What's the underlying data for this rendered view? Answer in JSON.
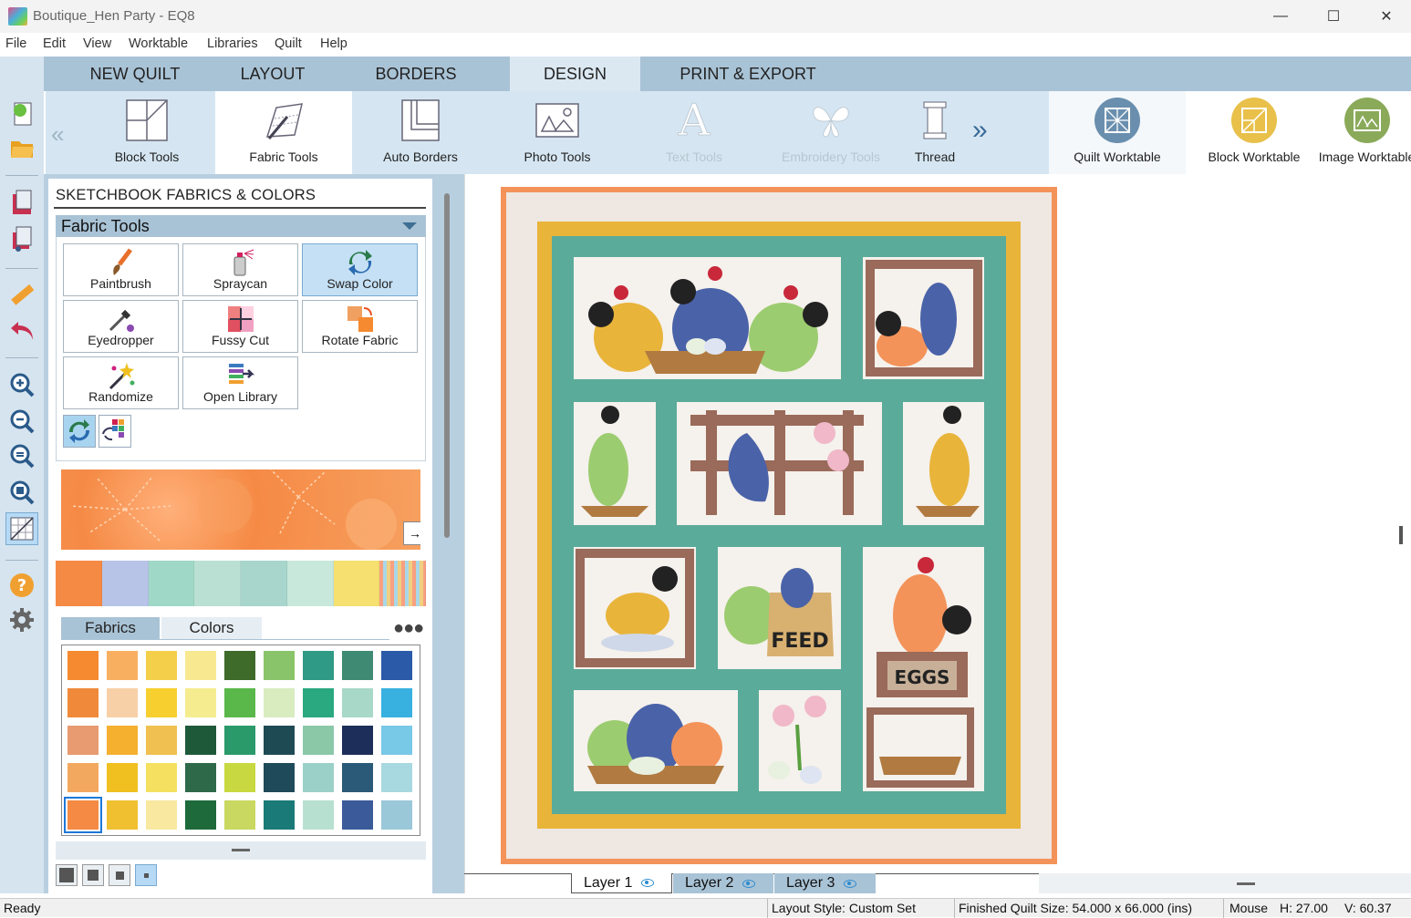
{
  "window": {
    "title": "Boutique_Hen Party - EQ8",
    "minimize": "—",
    "maximize": "☐",
    "close": "✕"
  },
  "menu": [
    "File",
    "Edit",
    "View",
    "Worktable",
    "Libraries",
    "Quilt",
    "Help"
  ],
  "tabs": [
    "NEW QUILT",
    "LAYOUT",
    "BORDERS",
    "DESIGN",
    "PRINT & EXPORT"
  ],
  "active_tab": "DESIGN",
  "ribbon": {
    "tools": [
      "Block Tools",
      "Fabric Tools",
      "Auto Borders",
      "Photo Tools",
      "Text Tools",
      "Embroidery Tools",
      "Thread"
    ],
    "worktables": [
      "Quilt Worktable",
      "Block Worktable",
      "Image Worktable"
    ],
    "prev": "«",
    "next": "»"
  },
  "pane": {
    "title": "SKETCHBOOK FABRICS & COLORS",
    "section": "Fabric Tools",
    "tools": [
      "Paintbrush",
      "Spraycan",
      "Swap Color",
      "Eyedropper",
      "Fussy Cut",
      "Rotate Fabric",
      "Randomize",
      "Open Library"
    ],
    "expand_glyph": "→]",
    "subtabs": [
      "Fabrics",
      "Colors"
    ],
    "more": "●●●"
  },
  "layers": [
    "Layer 1",
    "Layer 2",
    "Layer 3"
  ],
  "quilt_labels": {
    "feed": "FEED",
    "eggs": "EGGS"
  },
  "status": {
    "ready": "Ready",
    "layout_style": "Layout Style: Custom Set",
    "finished_size": "Finished Quilt Size: 54.000 x 66.000 (ins)",
    "mouse": "Mouse",
    "h": "H: 27.00",
    "v": "V: 60.37"
  },
  "colors": {
    "accent": "#a9c3d6",
    "teal": "#5aab9a",
    "gold": "#e8b43a",
    "orange": "#f3935a"
  }
}
